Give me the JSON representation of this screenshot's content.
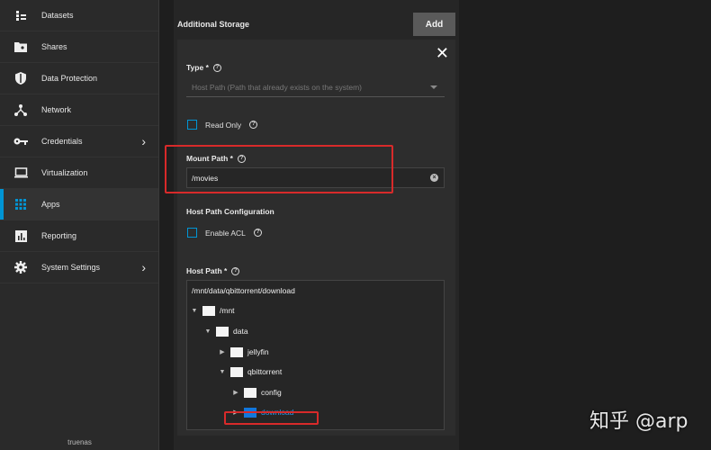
{
  "sidebar": {
    "items": [
      {
        "label": "Datasets",
        "icon": "datasets-icon",
        "chevron": false,
        "active": false
      },
      {
        "label": "Shares",
        "icon": "shares-icon",
        "chevron": false,
        "active": false
      },
      {
        "label": "Data Protection",
        "icon": "shield-icon",
        "chevron": false,
        "active": false
      },
      {
        "label": "Network",
        "icon": "network-icon",
        "chevron": false,
        "active": false
      },
      {
        "label": "Credentials",
        "icon": "key-icon",
        "chevron": true,
        "active": false
      },
      {
        "label": "Virtualization",
        "icon": "monitor-icon",
        "chevron": false,
        "active": false
      },
      {
        "label": "Apps",
        "icon": "apps-grid-icon",
        "chevron": false,
        "active": true
      },
      {
        "label": "Reporting",
        "icon": "chart-icon",
        "chevron": false,
        "active": false
      },
      {
        "label": "System Settings",
        "icon": "gear-icon",
        "chevron": true,
        "active": false
      }
    ],
    "footer": "truenas"
  },
  "panel": {
    "title": "Additional Storage",
    "add_label": "Add",
    "close_glyph": "✕"
  },
  "form": {
    "type_label": "Type *",
    "type_value": "Host Path (Path that already exists on the system)",
    "read_only_label": "Read Only",
    "mount_path_label": "Mount Path *",
    "mount_path_value": "/movies",
    "host_path_config_label": "Host Path Configuration",
    "enable_acl_label": "Enable ACL",
    "host_path_label": "Host Path *",
    "host_path_value": "/mnt/data/qbittorrent/download"
  },
  "tree": [
    {
      "name": "/mnt",
      "caret": "▼",
      "selected": false
    },
    {
      "name": "data",
      "caret": "▼",
      "selected": false
    },
    {
      "name": "jellyfin",
      "caret": "▶",
      "selected": false
    },
    {
      "name": "qbittorrent",
      "caret": "▼",
      "selected": false
    },
    {
      "name": "config",
      "caret": "▶",
      "selected": false
    },
    {
      "name": "download",
      "caret": "▶",
      "selected": true
    }
  ],
  "watermark": "知乎 @arp",
  "colors": {
    "accent": "#0095d5",
    "highlight": "#d82a2a",
    "selected_folder": "#1177dd"
  }
}
